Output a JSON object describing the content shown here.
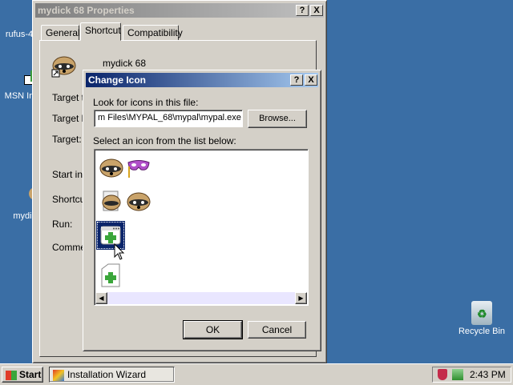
{
  "desktop": {
    "icons": [
      {
        "label": "rufus-4"
      },
      {
        "label": "MSN In"
      },
      {
        "label": "mydi"
      },
      {
        "label": "Recycle Bin"
      }
    ]
  },
  "properties_window": {
    "title": "mydick 68 Properties",
    "help_btn": "?",
    "close_btn": "X",
    "tabs": [
      {
        "label": "General"
      },
      {
        "label": "Shortcut"
      },
      {
        "label": "Compatibility"
      }
    ],
    "shortcut_name": "mydick 68",
    "fields": [
      {
        "label": "Target ty"
      },
      {
        "label": "Target lo"
      },
      {
        "label": "Target:"
      },
      {
        "label": "Start in:"
      },
      {
        "label": "Shortcu"
      },
      {
        "label": "Run:"
      },
      {
        "label": "Commer"
      }
    ]
  },
  "change_icon_dialog": {
    "title": "Change Icon",
    "help_btn": "?",
    "close_btn": "X",
    "look_label": "Look for icons in this file:",
    "file_path": "m Files\\MYPAL_68\\mypal\\mypal.exe",
    "browse_label": "Browse...",
    "list_label": "Select an icon from the list below:",
    "ok_label": "OK",
    "cancel_label": "Cancel",
    "icons": [
      {
        "name": "raccoon-icon"
      },
      {
        "name": "mask-icon"
      },
      {
        "name": "raccoon-doc-icon"
      },
      {
        "name": "raccoon-icon"
      },
      {
        "name": "window-plus-icon"
      },
      {
        "name": "doc-plus-icon"
      }
    ]
  },
  "taskbar": {
    "start_label": "Start",
    "task_label": "Installation Wizard",
    "time": "2:43 PM"
  }
}
